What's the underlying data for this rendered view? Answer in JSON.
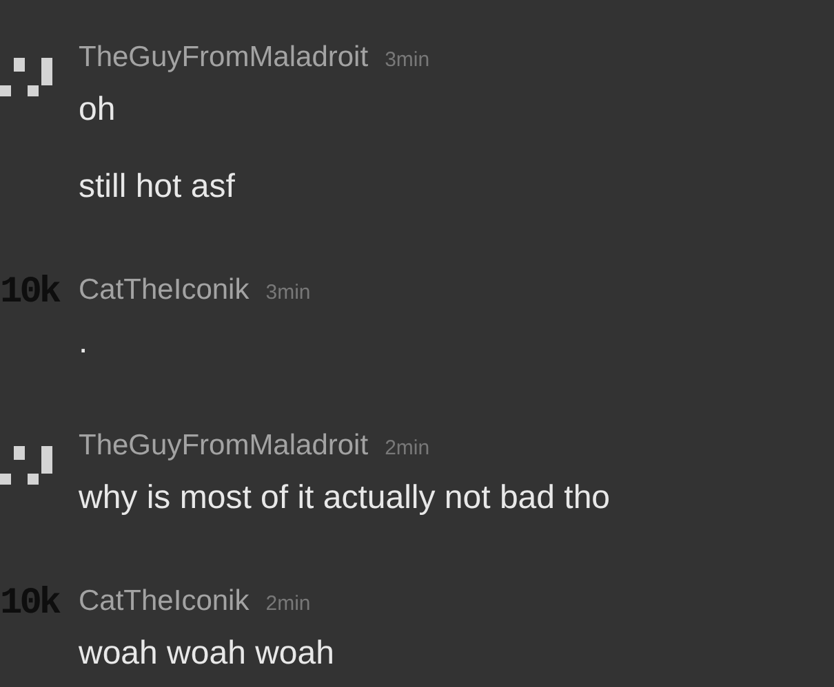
{
  "messages": [
    {
      "author": "TheGuyFromMaladroit",
      "time": "3min",
      "avatar": {
        "kind": "pixel"
      },
      "lines": [
        "oh",
        "still hot asf"
      ]
    },
    {
      "author": "CatTheIconik",
      "time": "3min",
      "avatar": {
        "kind": "text",
        "text": "10k"
      },
      "lines": [
        "."
      ]
    },
    {
      "author": "TheGuyFromMaladroit",
      "time": "2min",
      "avatar": {
        "kind": "pixel"
      },
      "lines": [
        "why is most of it actually not bad tho"
      ]
    },
    {
      "author": "CatTheIconik",
      "time": "2min",
      "avatar": {
        "kind": "text",
        "text": "10k"
      },
      "lines": [
        "woah woah woah"
      ]
    }
  ]
}
